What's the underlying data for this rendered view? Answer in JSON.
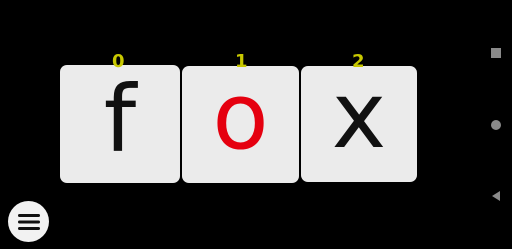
{
  "word": {
    "letters": [
      {
        "char": "f",
        "marker": "0",
        "color": "#111111"
      },
      {
        "char": "o",
        "marker": "1",
        "color": "#e5000f"
      },
      {
        "char": "x",
        "marker": "2",
        "color": "#111111"
      }
    ],
    "card_color": "#ebebeb",
    "marker_color": "#c8c800"
  },
  "menu": {
    "icon": "hamburger-menu-icon"
  },
  "system_nav": {
    "recents_icon": "square-recents-icon",
    "home_icon": "circle-home-icon",
    "back_icon": "triangle-back-icon"
  },
  "colors": {
    "background": "#000000",
    "nav_icons": "#8a8a8a"
  }
}
